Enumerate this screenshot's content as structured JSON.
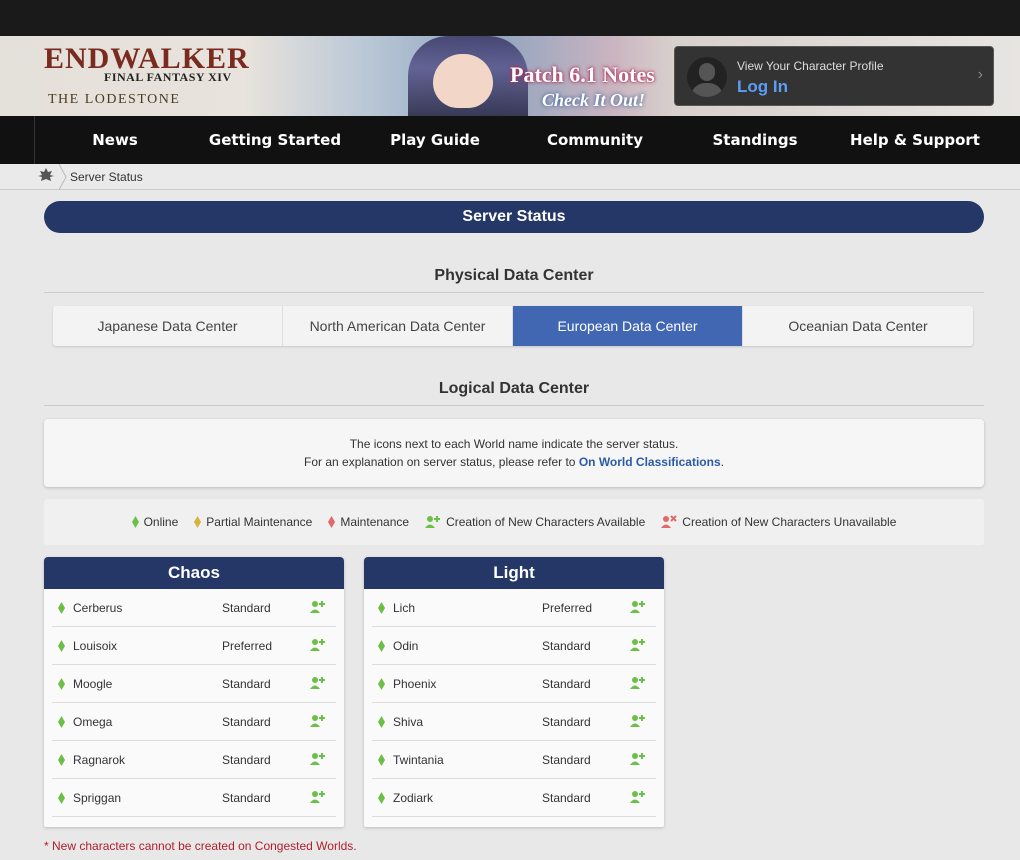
{
  "header": {
    "logo_title": "ENDWALKER",
    "logo_subtitle": "FINAL FANTASY XIV",
    "logo_lodestone": "THE LODESTONE",
    "banner_patch": "Patch 6.1 Notes",
    "banner_cta": "Check It Out!",
    "login_sub": "View Your Character Profile",
    "login_main": "Log In"
  },
  "nav": {
    "items": [
      "News",
      "Getting Started",
      "Play Guide",
      "Community",
      "Standings",
      "Help & Support"
    ]
  },
  "breadcrumb": {
    "current": "Server Status"
  },
  "page": {
    "title": "Server Status",
    "physical_heading": "Physical Data Center",
    "logical_heading": "Logical Data Center"
  },
  "tabs": [
    {
      "label": "Japanese Data Center",
      "active": false
    },
    {
      "label": "North American Data Center",
      "active": false
    },
    {
      "label": "European Data Center",
      "active": true
    },
    {
      "label": "Oceanian Data Center",
      "active": false
    }
  ],
  "info": {
    "line1": "The icons next to each World name indicate the server status.",
    "line2_prefix": "For an explanation on server status, please refer to ",
    "line2_link": "On World Classifications",
    "line2_suffix": "."
  },
  "legend": {
    "online": "Online",
    "partial": "Partial Maintenance",
    "maintenance": "Maintenance",
    "available": "Creation of New Characters Available",
    "unavailable": "Creation of New Characters Unavailable"
  },
  "colors": {
    "online": "#6cc04a",
    "partial": "#d4b43a",
    "maintenance": "#e06a6a",
    "create_available": "#6cc04a",
    "create_unavailable": "#e06a6a",
    "panel_header": "#253766",
    "tab_active": "#4166b2"
  },
  "datacenters": [
    {
      "name": "Chaos",
      "worlds": [
        {
          "name": "Cerberus",
          "classification": "Standard"
        },
        {
          "name": "Louisoix",
          "classification": "Preferred"
        },
        {
          "name": "Moogle",
          "classification": "Standard"
        },
        {
          "name": "Omega",
          "classification": "Standard"
        },
        {
          "name": "Ragnarok",
          "classification": "Standard"
        },
        {
          "name": "Spriggan",
          "classification": "Standard"
        }
      ]
    },
    {
      "name": "Light",
      "worlds": [
        {
          "name": "Lich",
          "classification": "Preferred"
        },
        {
          "name": "Odin",
          "classification": "Standard"
        },
        {
          "name": "Phoenix",
          "classification": "Standard"
        },
        {
          "name": "Shiva",
          "classification": "Standard"
        },
        {
          "name": "Twintania",
          "classification": "Standard"
        },
        {
          "name": "Zodiark",
          "classification": "Standard"
        }
      ]
    }
  ],
  "notes": {
    "congested": "* New characters cannot be created on Congested Worlds."
  }
}
